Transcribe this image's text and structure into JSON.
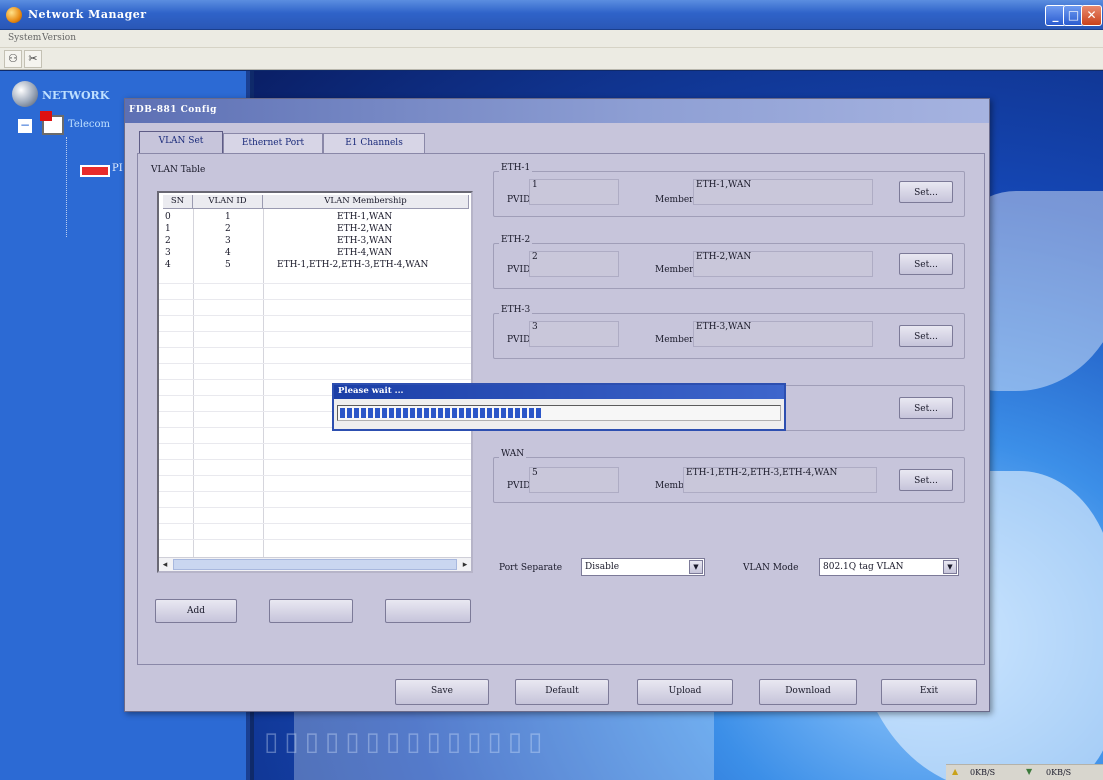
{
  "window": {
    "title": "Network Manager"
  },
  "menu": [
    "System",
    "Version"
  ],
  "tree": {
    "root_label": "NETWORK",
    "node_label": "Telecom",
    "child_label": "PI"
  },
  "dialog": {
    "title": "FDB-881 Config",
    "tabs": [
      "VLAN Set",
      "Ethernet Port",
      "E1 Channels"
    ],
    "vlan_group_title": "VLAN Table",
    "table": {
      "headers": [
        "SN",
        "VLAN ID",
        "VLAN Membership"
      ],
      "rows": [
        [
          "0",
          "1",
          "ETH-1,WAN"
        ],
        [
          "1",
          "2",
          "ETH-2,WAN"
        ],
        [
          "2",
          "3",
          "ETH-3,WAN"
        ],
        [
          "3",
          "4",
          "ETH-4,WAN"
        ],
        [
          "4",
          "5",
          "ETH-1,ETH-2,ETH-3,ETH-4,WAN"
        ]
      ]
    },
    "table_buttons": {
      "add": "Add"
    },
    "ports": [
      {
        "name": "ETH-1",
        "pvid": "1",
        "member": "ETH-1,WAN"
      },
      {
        "name": "ETH-2",
        "pvid": "2",
        "member": "ETH-2,WAN"
      },
      {
        "name": "ETH-3",
        "pvid": "3",
        "member": "ETH-3,WAN"
      },
      {
        "name": "",
        "pvid": "",
        "member": ""
      },
      {
        "name": "WAN",
        "pvid": "5",
        "member": "ETH-1,ETH-2,ETH-3,ETH-4,WAN"
      }
    ],
    "labels": {
      "pvid": "PVID",
      "member": "Member",
      "set": "Set..."
    },
    "port_separate": {
      "label": "Port Separate",
      "value": "Disable"
    },
    "vlan_mode": {
      "label": "VLAN Mode",
      "value": "802.1Q tag VLAN"
    },
    "footer_buttons": {
      "save": "Save",
      "default": "Default",
      "upload": "Upload",
      "download": "Download",
      "exit": "Exit"
    }
  },
  "wait_dialog": {
    "title": "Please wait ...",
    "progress_fraction": 0.46
  },
  "status": {
    "left": "0KB/S",
    "right": "0KB/S"
  }
}
